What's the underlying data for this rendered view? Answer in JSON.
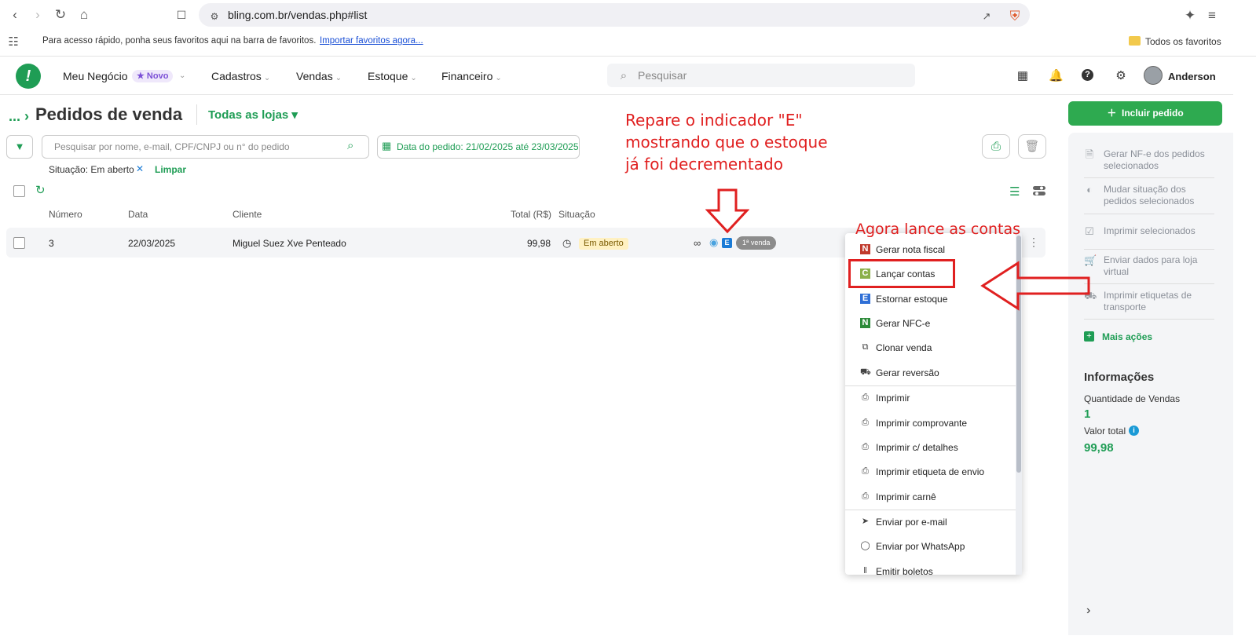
{
  "browser": {
    "url": "bling.com.br/vendas.php#list",
    "bookmarks_hint": "Para acesso rápido, ponha seus favoritos aqui na barra de favoritos.",
    "bookmarks_import": "Importar favoritos agora...",
    "all_bookmarks": "Todos os favoritos"
  },
  "header": {
    "nav": [
      {
        "label": "Meu Negócio"
      },
      {
        "label": "Cadastros"
      },
      {
        "label": "Vendas"
      },
      {
        "label": "Estoque"
      },
      {
        "label": "Financeiro"
      }
    ],
    "badge": "Novo",
    "search_placeholder": "Pesquisar",
    "user_name": "Anderson"
  },
  "page": {
    "breadcrumb": "...",
    "title": "Pedidos de venda",
    "stores": "Todas as lojas",
    "search_placeholder": "Pesquisar por nome, e-mail, CPF/CNPJ ou n° do pedido",
    "date_filter": "Data do pedido: 21/02/2025 até 23/03/2025",
    "status_filter": "Situação: Em aberto",
    "clear": "Limpar"
  },
  "table": {
    "columns": [
      "Número",
      "Data",
      "Cliente",
      "Total (R$)",
      "Situação"
    ],
    "rows": [
      {
        "number": "3",
        "date": "22/03/2025",
        "client": "Miguel Suez Xve Penteado",
        "total": "99,98",
        "status": "Em aberto",
        "stock_indicator": "E",
        "tag": "1ª venda"
      }
    ]
  },
  "menu": {
    "items": [
      {
        "label": "Gerar nota fiscal",
        "icon": "nf-icon"
      },
      {
        "label": "Lançar contas",
        "icon": "accounts-icon"
      },
      {
        "label": "Estornar estoque",
        "icon": "stock-reverse-icon"
      },
      {
        "label": "Gerar NFC-e",
        "icon": "nfce-icon"
      },
      {
        "label": "Clonar venda",
        "icon": "clone-icon"
      },
      {
        "label": "Gerar reversão",
        "icon": "truck-icon"
      },
      {
        "label": "Imprimir",
        "icon": "printer-icon"
      },
      {
        "label": "Imprimir comprovante",
        "icon": "printer-icon"
      },
      {
        "label": "Imprimir c/ detalhes",
        "icon": "printer-icon"
      },
      {
        "label": "Imprimir etiqueta de envio",
        "icon": "printer-icon"
      },
      {
        "label": "Imprimir carnê",
        "icon": "printer-icon"
      },
      {
        "label": "Enviar por e-mail",
        "icon": "send-icon"
      },
      {
        "label": "Enviar por WhatsApp",
        "icon": "whatsapp-icon"
      },
      {
        "label": "Emitir boletos",
        "icon": "barcode-icon"
      }
    ]
  },
  "sidebar": {
    "include_button": "Incluir pedido",
    "actions": [
      {
        "label": "Gerar NF-e dos pedidos selecionados",
        "icon": "document-icon"
      },
      {
        "label": "Mudar situação dos pedidos selecionados",
        "icon": "half-circle-icon"
      },
      {
        "label": "Imprimir selecionados",
        "icon": "check-square-icon"
      },
      {
        "label": "Enviar dados para loja virtual",
        "icon": "cart-icon"
      },
      {
        "label": "Imprimir etiquetas de transporte",
        "icon": "truck-icon"
      }
    ],
    "more_actions": "Mais ações",
    "info_title": "Informações",
    "qty_label": "Quantidade de Vendas",
    "qty_value": "1",
    "total_label": "Valor total",
    "total_value": "99,98"
  },
  "annotations": {
    "note1_line1": "Repare o indicador  \"E\"",
    "note1_line2": "mostrando que o estoque",
    "note1_line3": "já foi decrementado",
    "note2": "Agora lance as contas"
  },
  "colors": {
    "brand_green": "#1f9d55",
    "annotation_red": "#e02020",
    "status_yellow": "#fff1c2"
  }
}
